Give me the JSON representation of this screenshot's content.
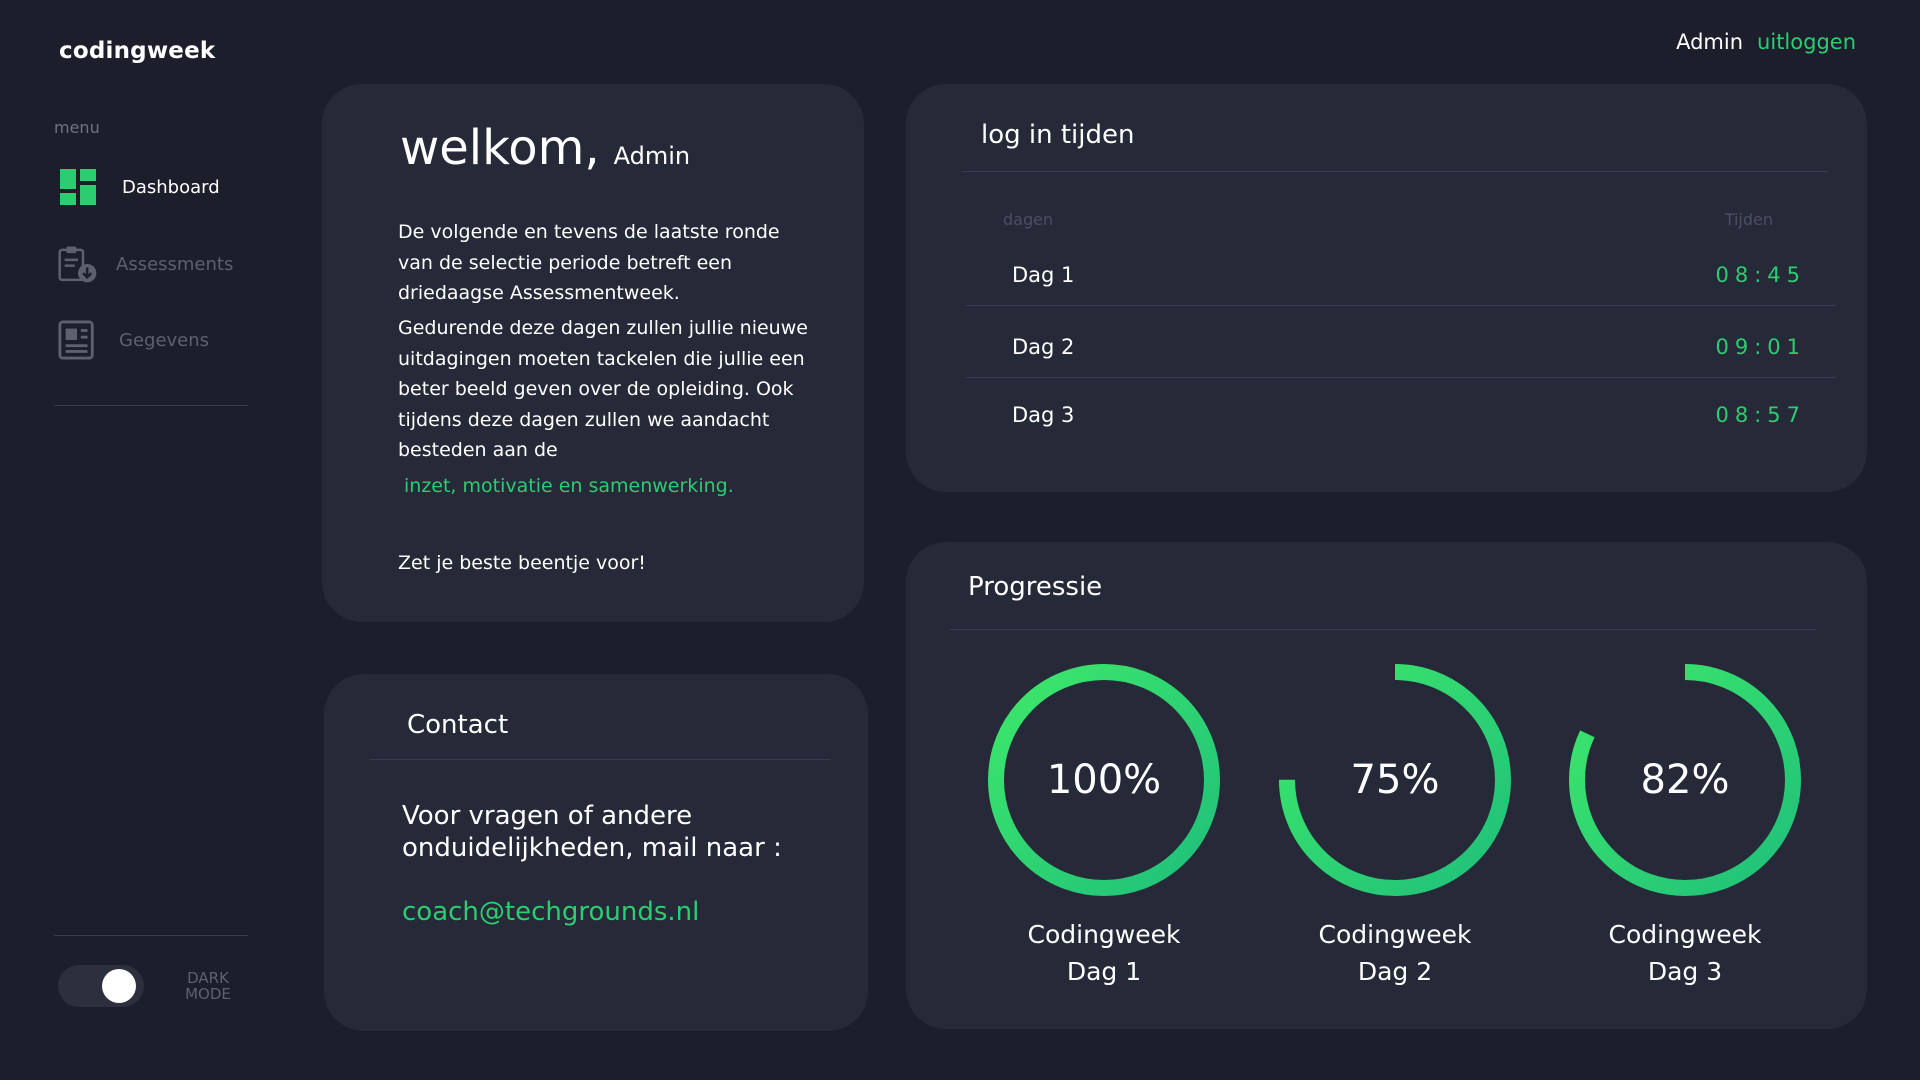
{
  "app": {
    "logo": "codingweek"
  },
  "sidebar": {
    "menu_caption": "menu",
    "items": [
      {
        "label": "Dashboard",
        "icon": "dashboard-icon",
        "active": true
      },
      {
        "label": "Assessments",
        "icon": "clipboard-download-icon",
        "active": false
      },
      {
        "label": "Gegevens",
        "icon": "document-icon",
        "active": false
      }
    ],
    "toggle": {
      "label_line1": "DARK",
      "label_line2": "MODE",
      "on": true
    }
  },
  "topbar": {
    "user": "Admin",
    "logout": "uitloggen"
  },
  "welcome": {
    "title": "welkom,",
    "name": "Admin",
    "paragraph1": "De volgende en tevens de laatste ronde van de selectie periode betreft een driedaagse Assessmentweek.",
    "paragraph2": "Gedurende deze dagen zullen jullie nieuwe uitdagingen moeten tackelen die jullie een beter beeld geven over de opleiding. Ook tijdens deze dagen zullen we aandacht besteden aan de",
    "highlight": "inzet, motivatie en samenwerking.",
    "closing": "Zet je beste beentje voor!"
  },
  "contact": {
    "title": "Contact",
    "text": "Voor vragen of andere onduidelijkheden, mail naar :",
    "email": "coach@techgrounds.nl"
  },
  "login_times": {
    "title": "log in tijden",
    "col_days": "dagen",
    "col_times": "Tijden",
    "rows": [
      {
        "day": "Dag 1",
        "time": "08:45"
      },
      {
        "day": "Dag 2",
        "time": "09:01"
      },
      {
        "day": "Dag 3",
        "time": "08:57"
      }
    ]
  },
  "progress": {
    "title": "Progressie",
    "items": [
      {
        "percent_label": "100%",
        "value": 1.0,
        "line1": "Codingweek",
        "line2": "Dag 1"
      },
      {
        "percent_label": "75%",
        "value": 0.75,
        "line1": "Codingweek",
        "line2": "Dag 2"
      },
      {
        "percent_label": "82%",
        "value": 0.82,
        "line1": "Codingweek",
        "line2": "Dag 3"
      }
    ],
    "colors": {
      "start": "#1fbf7a",
      "end": "#3ee86a"
    }
  }
}
